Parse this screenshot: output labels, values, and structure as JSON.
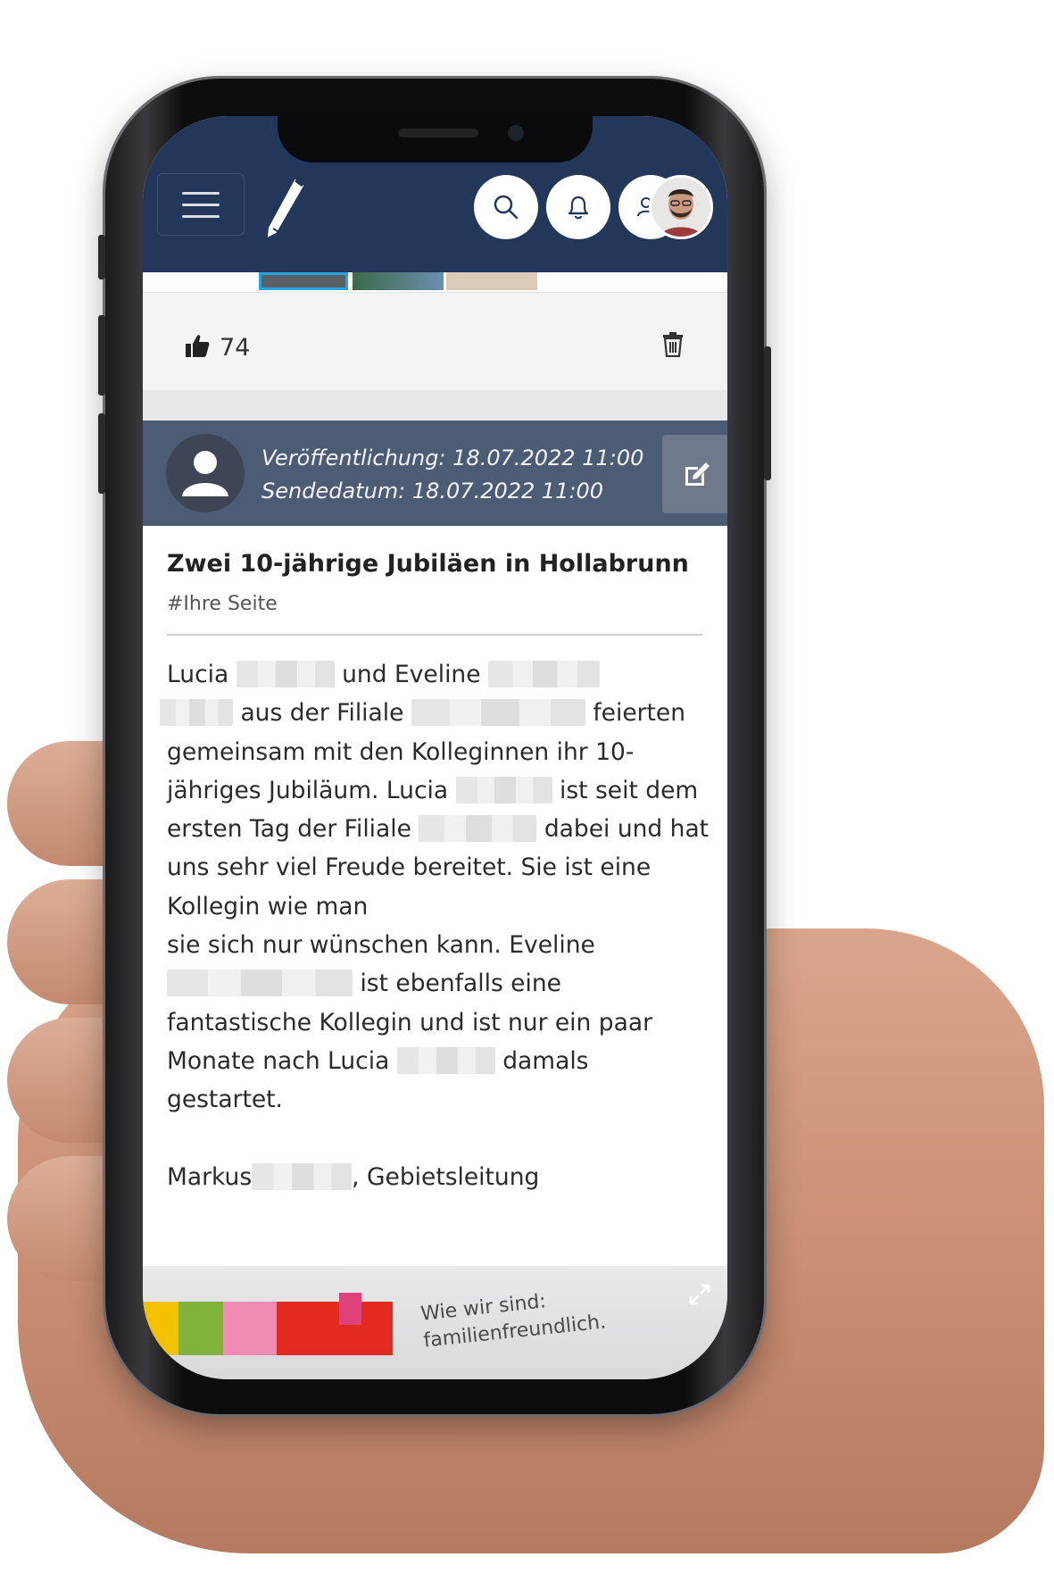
{
  "header": {
    "menu_icon": "hamburger-icon",
    "logo_icon": "pen-logo-icon",
    "actions": [
      "search-icon",
      "bell-icon",
      "users-icon"
    ],
    "avatar": "user-avatar"
  },
  "post_previous": {
    "like_count": "74",
    "like_icon": "thumbs-up-icon",
    "delete_icon": "trash-icon"
  },
  "post": {
    "published": "Veröffentlichung: 18.07.2022 11:00",
    "sent": "Sendedatum: 18.07.2022 11:00",
    "edit_icon": "edit-icon",
    "title": "Zwei 10-jährige Jubiläen in Hollabrunn",
    "tag": "#Ihre Seite",
    "body": {
      "p1_a": "Lucia",
      "p1_b": "und Eveline",
      "p1_c": "aus der Filiale",
      "p1_d": "feierten gemeinsam mit den Kolleginnen ihr 10-jähriges Jubiläum. Lucia",
      "p1_e": "ist seit dem ersten Tag der Filiale",
      "p1_f": "dabei und hat uns sehr viel Freude bereitet. Sie ist eine Kollegin wie man",
      "p2_a": "sie sich nur wünschen kann. Eveline",
      "p2_b": "ist ebenfalls eine fantastische Kollegin und ist nur ein paar Monate nach Lucia",
      "p2_c": "damals gestartet.",
      "sig_a": "Markus",
      "sig_b": ", Gebietsleitung"
    },
    "image_text_1": "Wie wir sind:",
    "image_text_2": "familienfreundlich.",
    "expand_icon": "expand-icon"
  },
  "colors": {
    "header_bg": "#23375a",
    "post_head_bg": "#4d5c75",
    "edit_btn_bg": "#6e7a8c"
  }
}
